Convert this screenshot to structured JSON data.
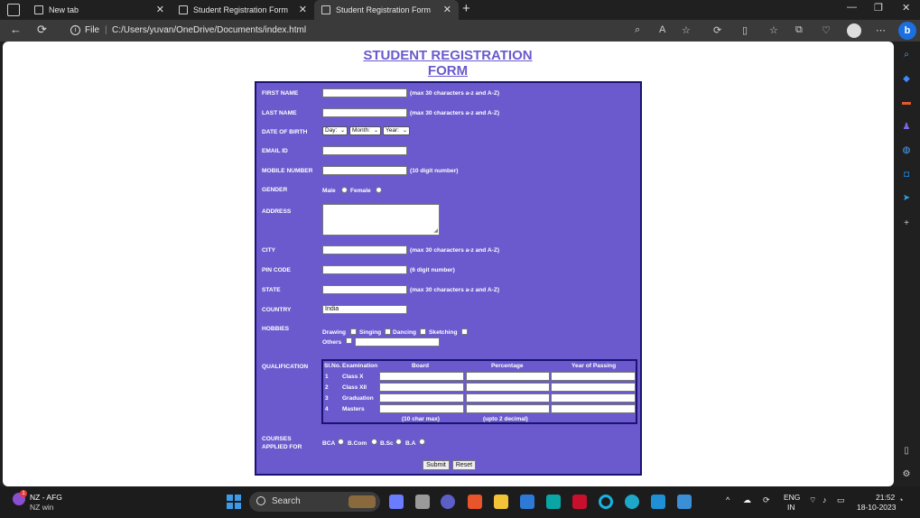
{
  "browser": {
    "tabs": [
      {
        "label": "New tab"
      },
      {
        "label": "Student Registration Form"
      },
      {
        "label": "Student Registration Form"
      }
    ],
    "close_glyph": "✕",
    "new_tab_glyph": "+",
    "window_controls": [
      "—",
      "❐",
      "✕"
    ],
    "nav": {
      "back": "←",
      "refresh": "⟳"
    },
    "address": {
      "info": "i",
      "scheme_label": "File",
      "separator": "|",
      "path": "C:/Users/yuvan/OneDrive/Documents/index.html"
    },
    "toolbar_icons": [
      "⌕",
      "A",
      "☆",
      "⟳",
      "▯",
      "☆",
      "⧉",
      "♡",
      "⋯"
    ],
    "bing_label": "b"
  },
  "page": {
    "title": "STUDENT REGISTRATION FORM",
    "labels": {
      "first_name": "FIRST NAME",
      "last_name": "LAST NAME",
      "dob": "DATE OF BIRTH",
      "email": "EMAIL ID",
      "mobile": "MOBILE NUMBER",
      "gender": "GENDER",
      "address": "ADDRESS",
      "city": "CITY",
      "pin": "PIN CODE",
      "state": "STATE",
      "country": "COUNTRY",
      "hobbies": "HOBBIES",
      "qualification": "QUALIFICATION",
      "courses_line1": "COURSES",
      "courses_line2": "APPLIED FOR"
    },
    "hints": {
      "first_name": "(max 30 characters a-z and A-Z)",
      "last_name": "(max 30 characters a-z and A-Z)",
      "mobile": "(10 digit number)",
      "city": "(max 30 characters a-z and A-Z)",
      "pin": "(6 digit number)",
      "state": "(max 30 characters a-z and A-Z)"
    },
    "dob_selects": {
      "day": "Day:",
      "month": "Month:",
      "year": "Year:",
      "arrow": "⌄"
    },
    "gender_options": [
      "Male",
      "Female"
    ],
    "country_value": "India",
    "hobbies": [
      "Drawing",
      "Singing",
      "Dancing",
      "Sketching",
      "Others"
    ],
    "qualification_table": {
      "headers": [
        "Sl.No.",
        "Examination",
        "Board",
        "Percentage",
        "Year of Passing"
      ],
      "rows": [
        {
          "num": "1",
          "exam": "Class X"
        },
        {
          "num": "2",
          "exam": "Class XII"
        },
        {
          "num": "3",
          "exam": "Graduation"
        },
        {
          "num": "4",
          "exam": "Masters"
        }
      ],
      "footer": {
        "board": "(10 char max)",
        "percentage": "(upto 2 decimal)"
      }
    },
    "courses": [
      "BCA",
      "B.Com",
      "B.Sc",
      "B.A"
    ],
    "buttons": {
      "submit": "Submit",
      "reset": "Reset"
    }
  },
  "taskbar": {
    "weather_line1": "NZ - AFG",
    "weather_line2": "NZ win",
    "weather_badge": "1",
    "search_label": "Search",
    "tray": {
      "chevron": "^",
      "lang_line1": "ENG",
      "lang_line2": "IN",
      "time": "21:52",
      "date": "18-10-2023"
    }
  }
}
